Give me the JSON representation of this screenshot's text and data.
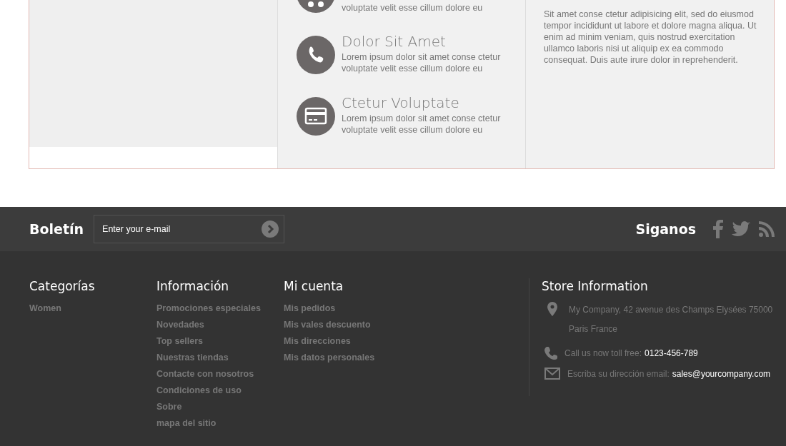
{
  "features": [
    {
      "kind": "cut",
      "text": "voluptate velit esse cillum dolore eu"
    },
    {
      "kind": "full",
      "title": "Dolor Sit Amet",
      "text": "Lorem ipsum dolor sit amet conse ctetur voluptate velit esse cillum dolore eu"
    },
    {
      "kind": "full",
      "title": "Ctetur Voluptate",
      "text": "Lorem ipsum dolor sit amet conse ctetur voluptate velit esse cillum dolore eu"
    }
  ],
  "about_text": "Sit amet conse ctetur adipisicing elit, sed do eiusmod tempor incididunt ut labore et dolore magna aliqua. Ut enim ad minim veniam, quis nostrud exercitation ullamco laboris nisi ut aliquip ex ea commodo consequat. Duis aute irure dolor in reprehenderit.",
  "newsletter": {
    "title": "Boletín",
    "placeholder": "Enter your e-mail"
  },
  "social": {
    "title": "Siganos",
    "networks": [
      {
        "kind": "facebook"
      },
      {
        "kind": "twitter"
      },
      {
        "kind": "rss"
      }
    ]
  },
  "columns": [
    {
      "title": "Categorías",
      "links": [
        "Women"
      ]
    },
    {
      "title": "Información",
      "links": [
        "Promociones especiales",
        "Novedades",
        "Top sellers",
        "Nuestras tiendas",
        "Contacte con nosotros",
        "Condiciones de uso",
        "Sobre",
        "mapa del sitio"
      ]
    },
    {
      "title": "Mi cuenta",
      "links": [
        "Mis pedidos",
        "Mis vales descuento",
        "Mis direcciones",
        "Mis datos personales"
      ]
    }
  ],
  "store": {
    "title": "Store Information",
    "rows": [
      {
        "kind": "address",
        "text": "My Company, 42 avenue des Champs Elysées 75000 Paris France"
      },
      {
        "kind": "phone",
        "label": "Call us now toll free:",
        "value": "0123-456-789"
      },
      {
        "kind": "email",
        "label": "Escriba su dirección email:",
        "value": "sales@yourcompany.com"
      }
    ]
  }
}
